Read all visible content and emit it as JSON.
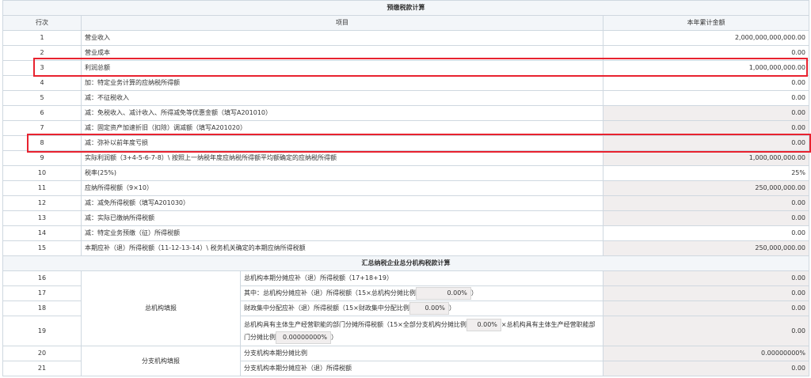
{
  "section1": {
    "title": "预缴税款计算",
    "headers": {
      "no": "行次",
      "item": "项目",
      "amount": "本年累计金额"
    },
    "rows": [
      {
        "no": "1",
        "item": "营业收入",
        "amount": "2,000,000,000,000.00",
        "grey": false
      },
      {
        "no": "2",
        "item": "营业成本",
        "amount": "0.00",
        "grey": false
      },
      {
        "no": "3",
        "item": "利润总额",
        "amount": "1,000,000,000.00",
        "grey": false
      },
      {
        "no": "4",
        "item": "加：特定业务计算的应纳税所得额",
        "amount": "0.00",
        "grey": false
      },
      {
        "no": "5",
        "item": "减：不征税收入",
        "amount": "0.00",
        "grey": false
      },
      {
        "no": "6",
        "item": "减：免税收入、减计收入、所得减免等优惠金额（填写A201010）",
        "amount": "0.00",
        "grey": true
      },
      {
        "no": "7",
        "item": "减：固定资产加速折旧（扣除）调减额（填写A201020）",
        "amount": "0.00",
        "grey": true
      },
      {
        "no": "8",
        "item": "减：弥补以前年度亏损",
        "amount": "0.00",
        "grey": true
      },
      {
        "no": "9",
        "item": "实际利润额（3+4-5-6-7-8）\\ 按照上一纳税年度应纳税所得额平均额确定的应纳税所得额",
        "amount": "1,000,000,000.00",
        "grey": true
      },
      {
        "no": "10",
        "item": "税率(25%)",
        "amount": "25%",
        "grey": false
      },
      {
        "no": "11",
        "item": "应纳所得税额（9×10）",
        "amount": "250,000,000.00",
        "grey": true
      },
      {
        "no": "12",
        "item": "减：减免所得税额（填写A201030）",
        "amount": "0.00",
        "grey": true
      },
      {
        "no": "13",
        "item": "减：实际已缴纳所得税额",
        "amount": "0.00",
        "grey": true
      },
      {
        "no": "14",
        "item": "减：特定业务预缴（征）所得税额",
        "amount": "0.00",
        "grey": false
      },
      {
        "no": "15",
        "item": "本期应补（退）所得税额（11-12-13-14）\\ 税务机关确定的本期应纳所得税额",
        "amount": "250,000,000.00",
        "grey": true
      }
    ]
  },
  "section2": {
    "title": "汇总纳税企业总分机构税款计算",
    "group_hq": "总机构填报",
    "group_branch": "分支机构填报",
    "rows": {
      "r16": {
        "no": "16",
        "item": "总机构本期分摊应补（退）所得税额（17+18+19）",
        "amount": "0.00"
      },
      "r17": {
        "no": "17",
        "item_before": "其中：总机构分摊应补（退）所得税额（15×总机构分摊比例",
        "ratio": "0.00%",
        "item_after": "）",
        "amount": "0.00"
      },
      "r18": {
        "no": "18",
        "item_before": "财政集中分配应补（退）所得税额（15×财政集中分配比例",
        "ratio": "0.00%",
        "item_after": "）",
        "amount": "0.00"
      },
      "r19": {
        "no": "19",
        "item_before": "总机构具有主体生产经营职能的部门分摊所得税额（15×全部分支机构分摊比例",
        "ratio1": "0.00%",
        "item_mid": "×总机构具有主体生产经营职能部门分摊比例",
        "ratio2": "0.00000000%",
        "item_after": "）",
        "amount": "0.00"
      },
      "r20": {
        "no": "20",
        "item": "分支机构本期分摊比例",
        "amount": "0.00000000%"
      },
      "r21": {
        "no": "21",
        "item": "分支机构本期分摊应补（退）所得税额",
        "amount": "0.00"
      }
    }
  },
  "colors": {
    "border": "#cfd8e0",
    "header_bg": "#f3f6f9",
    "readonly_bg": "#f1eeee",
    "highlight": "#e8222f"
  }
}
